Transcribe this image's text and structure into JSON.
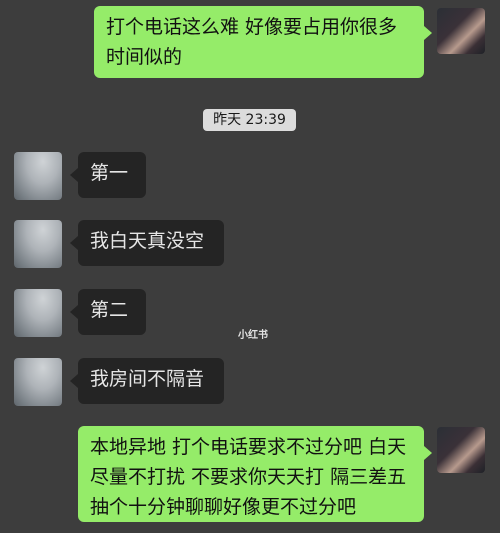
{
  "messages": [
    {
      "side": "sent",
      "text": "打个电话这么难 好像要占用你很多时间似的"
    },
    {
      "side": "recv",
      "text": "第一"
    },
    {
      "side": "recv",
      "text": "我白天真没空"
    },
    {
      "side": "recv",
      "text": "第二"
    },
    {
      "side": "recv",
      "text": "我房间不隔音"
    },
    {
      "side": "sent",
      "text": "本地异地 打个电话要求不过分吧 白天尽量不打扰 不要求你天天打 隔三差五抽个十分钟聊聊好像更不过分吧"
    }
  ],
  "timestamp": "昨天 23:39",
  "watermark": "小红书",
  "colors": {
    "background": "#3d3d3d",
    "sent_bubble": "#95ec69",
    "recv_bubble": "#242424",
    "timestamp_bg": "#dcdcdc"
  }
}
